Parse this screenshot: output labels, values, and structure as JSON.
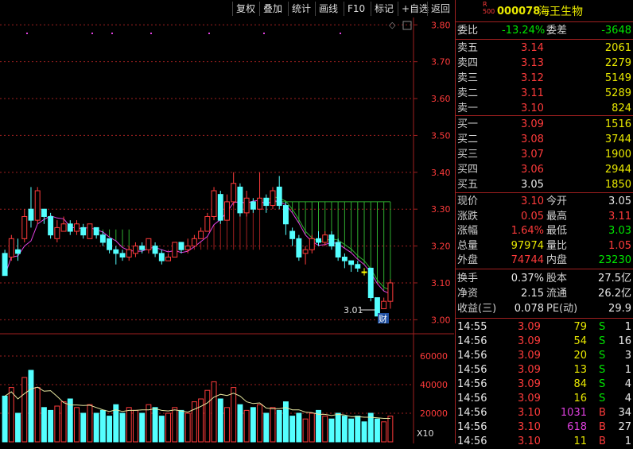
{
  "toolbar": {
    "buttons": [
      "复权",
      "叠加",
      "统计",
      "画线",
      "F10",
      "标记",
      "+自选",
      "返回"
    ]
  },
  "colors": {
    "up": "#ff3b3b",
    "down": "#54ffff",
    "flat": "#ffff00",
    "ma": "#e040e0",
    "grid": "#a02020",
    "volume_ma": "#e8e8a0"
  },
  "header": {
    "index_badge_top": "R",
    "index_badge_bottom": "500",
    "code": "000078",
    "name": "海王生物"
  },
  "summary": {
    "weibi_label": "委比",
    "weibi": "-13.24%",
    "weicha_label": "委差",
    "weicha": "-3648"
  },
  "order_book": {
    "asks": [
      {
        "label": "卖五",
        "price": "3.14",
        "volume": "2061"
      },
      {
        "label": "卖四",
        "price": "3.13",
        "volume": "2279"
      },
      {
        "label": "卖三",
        "price": "3.12",
        "volume": "5149"
      },
      {
        "label": "卖二",
        "price": "3.11",
        "volume": "5289"
      },
      {
        "label": "卖一",
        "price": "3.10",
        "volume": "824"
      }
    ],
    "bids": [
      {
        "label": "买一",
        "price": "3.09",
        "volume": "1516"
      },
      {
        "label": "买二",
        "price": "3.08",
        "volume": "3744"
      },
      {
        "label": "买三",
        "price": "3.07",
        "volume": "1900"
      },
      {
        "label": "买四",
        "price": "3.06",
        "volume": "2944"
      },
      {
        "label": "买五",
        "price": "3.05",
        "volume": "1850"
      }
    ]
  },
  "quote": [
    {
      "l1": "现价",
      "v1": "3.10",
      "c1": "red",
      "l2": "今开",
      "v2": "3.05",
      "c2": "white"
    },
    {
      "l1": "涨跌",
      "v1": "0.05",
      "c1": "red",
      "l2": "最高",
      "v2": "3.11",
      "c2": "red"
    },
    {
      "l1": "涨幅",
      "v1": "1.64%",
      "c1": "red",
      "l2": "最低",
      "v2": "3.03",
      "c2": "green"
    },
    {
      "l1": "总量",
      "v1": "97974",
      "c1": "yellow",
      "l2": "量比",
      "v2": "1.05",
      "c2": "red"
    },
    {
      "l1": "外盘",
      "v1": "74744",
      "c1": "red",
      "l2": "内盘",
      "v2": "23230",
      "c2": "green"
    }
  ],
  "fundamentals": [
    {
      "l1": "换手",
      "v1": "0.37%",
      "l2": "股本",
      "v2": "27.5亿"
    },
    {
      "l1": "净资",
      "v1": "2.15",
      "l2": "流通",
      "v2": "26.2亿"
    },
    {
      "l1": "收益(三)",
      "v1": "0.078",
      "l2": "PE(动)",
      "v2": "29.9"
    }
  ],
  "ticks": [
    {
      "time": "14:55",
      "price": "3.09",
      "vol": "79",
      "vc": "yellow",
      "side": "S",
      "n": "1"
    },
    {
      "time": "14:56",
      "price": "3.09",
      "vol": "54",
      "vc": "yellow",
      "side": "S",
      "n": "16"
    },
    {
      "time": "14:56",
      "price": "3.09",
      "vol": "20",
      "vc": "yellow",
      "side": "S",
      "n": "3"
    },
    {
      "time": "14:56",
      "price": "3.09",
      "vol": "13",
      "vc": "yellow",
      "side": "S",
      "n": "1"
    },
    {
      "time": "14:56",
      "price": "3.09",
      "vol": "84",
      "vc": "yellow",
      "side": "S",
      "n": "4"
    },
    {
      "time": "14:56",
      "price": "3.09",
      "vol": "16",
      "vc": "yellow",
      "side": "S",
      "n": "4"
    },
    {
      "time": "14:56",
      "price": "3.10",
      "vol": "1031",
      "vc": "magenta",
      "side": "B",
      "n": "34"
    },
    {
      "time": "14:56",
      "price": "3.10",
      "vol": "618",
      "vc": "magenta",
      "side": "B",
      "n": "27"
    },
    {
      "time": "14:56",
      "price": "3.10",
      "vol": "11",
      "vc": "yellow",
      "side": "B",
      "n": "1"
    }
  ],
  "chart_data": {
    "type": "candlestick",
    "price_ticks": [
      "3.80",
      "3.70",
      "3.60",
      "3.50",
      "3.40",
      "3.30",
      "3.20",
      "3.10",
      "3.00"
    ],
    "ylim": [
      2.99,
      3.82
    ],
    "volume_ticks": [
      "60000",
      "40000",
      "20000"
    ],
    "volume_unit_label": "X10",
    "low_annotation": "3.01",
    "event_marker": "财",
    "candles": [
      [
        3.18,
        3.12,
        3.19,
        3.12
      ],
      [
        3.17,
        3.22,
        3.23,
        3.16
      ],
      [
        3.19,
        3.18,
        3.22,
        3.16
      ],
      [
        3.22,
        3.28,
        3.3,
        3.21
      ],
      [
        3.3,
        3.27,
        3.36,
        3.25
      ],
      [
        3.27,
        3.35,
        3.36,
        3.26
      ],
      [
        3.3,
        3.28,
        3.3,
        3.26
      ],
      [
        3.28,
        3.23,
        3.29,
        3.22
      ],
      [
        3.22,
        3.25,
        3.27,
        3.21
      ],
      [
        3.24,
        3.26,
        3.28,
        3.24
      ],
      [
        3.26,
        3.24,
        3.27,
        3.23
      ],
      [
        3.24,
        3.26,
        3.27,
        3.23
      ],
      [
        3.25,
        3.23,
        3.26,
        3.22
      ],
      [
        3.22,
        3.26,
        3.26,
        3.22
      ],
      [
        3.25,
        3.23,
        3.25,
        3.22
      ],
      [
        3.23,
        3.21,
        3.24,
        3.2
      ],
      [
        3.22,
        3.19,
        3.22,
        3.18
      ],
      [
        3.19,
        3.18,
        3.2,
        3.15
      ],
      [
        3.18,
        3.17,
        3.19,
        3.16
      ],
      [
        3.17,
        3.19,
        3.2,
        3.16
      ],
      [
        3.18,
        3.2,
        3.21,
        3.17
      ],
      [
        3.2,
        3.19,
        3.21,
        3.18
      ],
      [
        3.19,
        3.22,
        3.22,
        3.18
      ],
      [
        3.2,
        3.18,
        3.21,
        3.17
      ],
      [
        3.18,
        3.16,
        3.19,
        3.15
      ],
      [
        3.16,
        3.17,
        3.18,
        3.16
      ],
      [
        3.17,
        3.21,
        3.21,
        3.17
      ],
      [
        3.21,
        3.19,
        3.21,
        3.18
      ],
      [
        3.19,
        3.2,
        3.22,
        3.18
      ],
      [
        3.2,
        3.22,
        3.23,
        3.2
      ],
      [
        3.22,
        3.24,
        3.25,
        3.22
      ],
      [
        3.24,
        3.28,
        3.29,
        3.24
      ],
      [
        3.28,
        3.35,
        3.36,
        3.27
      ],
      [
        3.34,
        3.27,
        3.35,
        3.26
      ],
      [
        3.27,
        3.32,
        3.34,
        3.27
      ],
      [
        3.32,
        3.37,
        3.4,
        3.31
      ],
      [
        3.36,
        3.29,
        3.37,
        3.28
      ],
      [
        3.29,
        3.33,
        3.35,
        3.28
      ],
      [
        3.32,
        3.3,
        3.33,
        3.29
      ],
      [
        3.3,
        3.33,
        3.4,
        3.3
      ],
      [
        3.33,
        3.31,
        3.34,
        3.29
      ],
      [
        3.31,
        3.35,
        3.36,
        3.3
      ],
      [
        3.36,
        3.31,
        3.39,
        3.3
      ],
      [
        3.31,
        3.26,
        3.32,
        3.23
      ],
      [
        3.24,
        3.22,
        3.25,
        3.2
      ],
      [
        3.22,
        3.17,
        3.23,
        3.16
      ],
      [
        3.18,
        3.19,
        3.2,
        3.15
      ],
      [
        3.19,
        3.22,
        3.23,
        3.18
      ],
      [
        3.22,
        3.21,
        3.24,
        3.2
      ],
      [
        3.21,
        3.23,
        3.24,
        3.2
      ],
      [
        3.23,
        3.2,
        3.24,
        3.19
      ],
      [
        3.21,
        3.17,
        3.22,
        3.16
      ],
      [
        3.17,
        3.16,
        3.18,
        3.14
      ],
      [
        3.16,
        3.15,
        3.16,
        3.13
      ],
      [
        3.15,
        3.14,
        3.16,
        3.13
      ],
      [
        3.13,
        3.13,
        3.14,
        3.12
      ],
      [
        3.14,
        3.06,
        3.14,
        3.05
      ],
      [
        3.06,
        3.01,
        3.06,
        3.01
      ],
      [
        3.03,
        3.05,
        3.06,
        3.03
      ],
      [
        3.05,
        3.1,
        3.11,
        3.03
      ]
    ],
    "volumes": [
      32,
      38,
      20,
      45,
      50,
      38,
      24,
      22,
      25,
      28,
      30,
      24,
      20,
      26,
      20,
      22,
      18,
      26,
      20,
      24,
      22,
      20,
      26,
      24,
      18,
      20,
      24,
      22,
      20,
      28,
      30,
      36,
      42,
      30,
      24,
      38,
      26,
      22,
      24,
      26,
      20,
      24,
      22,
      28,
      18,
      20,
      16,
      20,
      22,
      18,
      16,
      20,
      18,
      16,
      18,
      14,
      20,
      16,
      14,
      18
    ]
  }
}
